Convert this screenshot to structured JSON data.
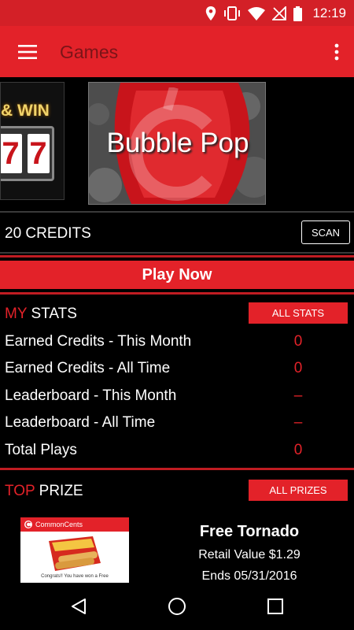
{
  "status_bar": {
    "time": "12:19",
    "icons": [
      "location-icon",
      "vibrate-icon",
      "wifi-icon",
      "no-signal-icon",
      "battery-icon"
    ],
    "color": "#d32027"
  },
  "app_bar": {
    "title": "Games",
    "menu_icon": "hamburger-menu-icon",
    "overflow_icon": "overflow-menu-icon",
    "color": "#e32229"
  },
  "carousel": {
    "tiles": [
      {
        "title": "& WIN",
        "reels": [
          "7",
          "7"
        ]
      },
      {
        "title": "Bubble Pop"
      }
    ]
  },
  "credits": {
    "text": "20 CREDITS",
    "scan_label": "SCAN"
  },
  "play_now_label": "Play Now",
  "stats": {
    "heading_accent": "MY",
    "heading_rest": " STATS",
    "button_label": "ALL STATS",
    "rows": [
      {
        "label": "Earned Credits - This Month",
        "value": "0"
      },
      {
        "label": "Earned Credits - All Time",
        "value": "0"
      },
      {
        "label": "Leaderboard - This Month",
        "value": "–"
      },
      {
        "label": "Leaderboard - All Time",
        "value": "–"
      },
      {
        "label": "Total Plays",
        "value": "0"
      }
    ]
  },
  "prize": {
    "heading_accent": "TOP",
    "heading_rest": " PRIZE",
    "button_label": "ALL PRIZES",
    "image": {
      "logo_text": "CommonCents",
      "caption": "Congrats!! You have won a Free"
    },
    "name": "Free Tornado",
    "retail_value": "Retail Value $1.29",
    "ends": "Ends 05/31/2016"
  },
  "nav_bar": {
    "icons": [
      "back-icon",
      "home-icon",
      "recents-icon"
    ]
  }
}
